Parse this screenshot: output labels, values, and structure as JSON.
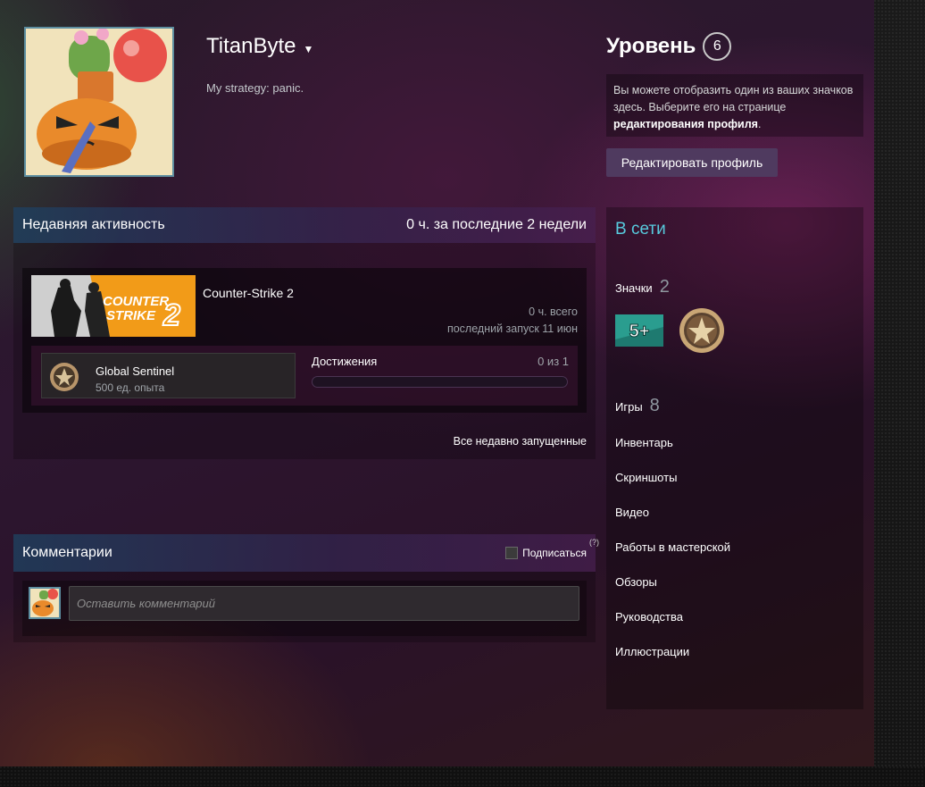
{
  "profile": {
    "name": "TitanByte",
    "summary": "My strategy: panic."
  },
  "level": {
    "label": "Уровень",
    "value": "6"
  },
  "badge_hint": {
    "text": "Вы можете отобразить один из ваших значков здесь. Выберите его на странице ",
    "link": "редактирования профиля",
    "tail": "."
  },
  "edit_profile_label": "Редактировать профиль",
  "activity": {
    "title": "Недавняя активность",
    "hours_summary": "0 ч. за последние 2 недели",
    "game": {
      "name": "Counter-Strike 2",
      "capsule_text_1": "COUNTER",
      "capsule_text_2": "STRIKE",
      "hours_total": "0 ч. всего",
      "last_played": "последний запуск 11 июн",
      "badge_name": "Global Sentinel",
      "badge_xp": "500 ед. опыта",
      "achievements_label": "Достижения",
      "achievements_count": "0 из 1",
      "achievements_progress": 0
    },
    "all_recent": "Все недавно запущенные"
  },
  "comments": {
    "title": "Комментарии",
    "subscribe_label": "Подписаться",
    "help": "(?)",
    "placeholder": "Оставить комментарий"
  },
  "sidebar": {
    "status": "В сети",
    "badges_label": "Значки",
    "badges_count": "2",
    "games_label": "Игры",
    "games_count": "8",
    "badge1_text": "5+",
    "links": [
      "Инвентарь",
      "Скриншоты",
      "Видео",
      "Работы в мастерской",
      "Обзоры",
      "Руководства",
      "Иллюстрации"
    ]
  },
  "colors": {
    "online": "#57cbde",
    "edit_button": "#4f3a5f"
  }
}
